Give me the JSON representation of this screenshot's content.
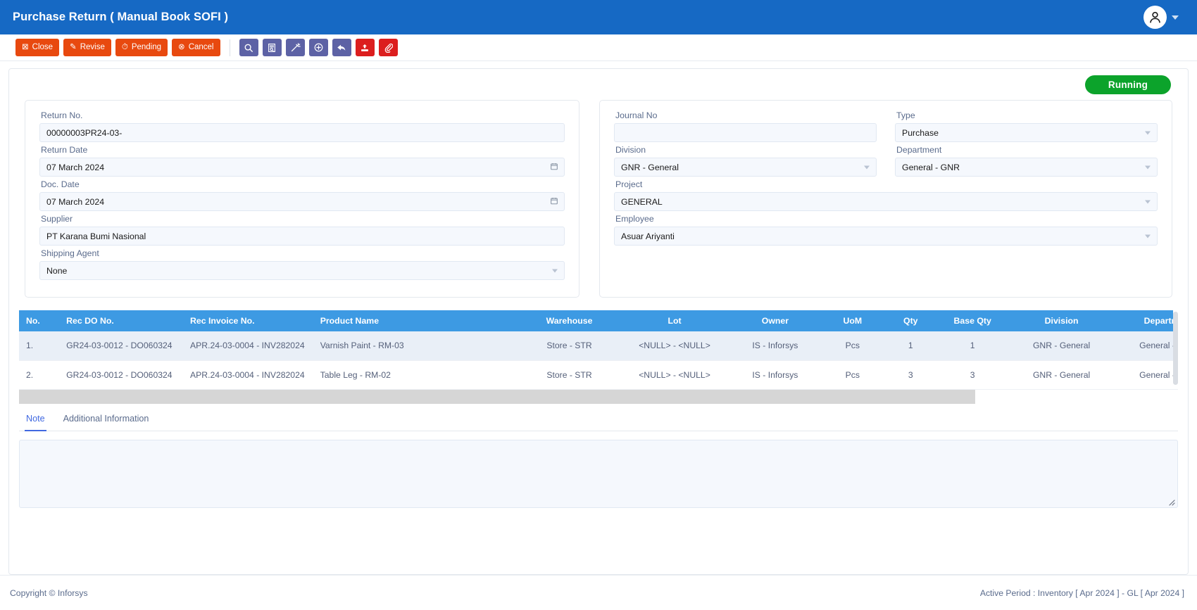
{
  "titlebar": {
    "title": "Purchase Return ( Manual Book SOFI )",
    "avatar_icon": "user-avatar-icon",
    "caret_icon": "chevron-down-icon"
  },
  "toolbar": {
    "buttons": [
      {
        "label": "Close",
        "glyph": "⊠",
        "icon": "close-box-icon"
      },
      {
        "label": "Revise",
        "glyph": "✎",
        "icon": "pencil-square-icon"
      },
      {
        "label": "Pending",
        "glyph": "◴",
        "icon": "clock-icon"
      },
      {
        "label": "Cancel",
        "glyph": "⊗",
        "icon": "cancel-circle-icon"
      }
    ],
    "icon_buttons": [
      {
        "name": "search-icon",
        "color": "#5d62a5"
      },
      {
        "name": "document-search-icon",
        "color": "#5d62a5"
      },
      {
        "name": "magic-wand-icon",
        "color": "#5d62a5"
      },
      {
        "name": "add-circle-icon",
        "color": "#5d62a5"
      },
      {
        "name": "undo-arrow-icon",
        "color": "#5d62a5"
      },
      {
        "name": "upload-icon",
        "color": "#dc1e1e"
      },
      {
        "name": "attachment-icon",
        "color": "#dc1e1e"
      }
    ]
  },
  "status": {
    "label": "Running",
    "color": "#0ca32b"
  },
  "form_left": {
    "return_no": {
      "label": "Return No.",
      "value": "00000003PR24-03-"
    },
    "return_date": {
      "label": "Return Date",
      "value": "07 March 2024",
      "icon": "calendar-icon"
    },
    "doc_date": {
      "label": "Doc. Date",
      "value": "07 March 2024",
      "icon": "calendar-icon"
    },
    "supplier": {
      "label": "Supplier",
      "value": "PT Karana Bumi Nasional"
    },
    "shipping_agent": {
      "label": "Shipping Agent",
      "value": "None",
      "icon": "chevron-down-icon"
    }
  },
  "form_right": {
    "journal_no": {
      "label": "Journal No",
      "value": "",
      "placeholder": ""
    },
    "type": {
      "label": "Type",
      "value": "Purchase",
      "icon": "chevron-down-icon"
    },
    "division": {
      "label": "Division",
      "value": "GNR - General",
      "icon": "chevron-down-icon"
    },
    "department": {
      "label": "Department",
      "value": "General - GNR",
      "icon": "chevron-down-icon"
    },
    "project": {
      "label": "Project",
      "value": "GENERAL",
      "icon": "chevron-down-icon"
    },
    "employee": {
      "label": "Employee",
      "value": "Asuar Ariyanti",
      "icon": "chevron-down-icon"
    }
  },
  "table": {
    "headers": [
      "No.",
      "Rec DO No.",
      "Rec Invoice No.",
      "Product Name",
      "Warehouse",
      "Lot",
      "Owner",
      "UoM",
      "Qty",
      "Base Qty",
      "Division",
      "Department"
    ],
    "rows": [
      {
        "no": "1.",
        "rec_do_no": "GR24-03-0012 - DO060324",
        "rec_invoice_no": "APR.24-03-0004 - INV282024",
        "product_name": "Varnish Paint - RM-03",
        "warehouse": "Store - STR",
        "lot": "<NULL> - <NULL>",
        "owner": "IS - Inforsys",
        "uom": "Pcs",
        "qty": "1",
        "base_qty": "1",
        "division": "GNR - General",
        "department": "General - GNR"
      },
      {
        "no": "2.",
        "rec_do_no": "GR24-03-0012 - DO060324",
        "rec_invoice_no": "APR.24-03-0004 - INV282024",
        "product_name": "Table Leg - RM-02",
        "warehouse": "Store - STR",
        "lot": "<NULL> - <NULL>",
        "owner": "IS - Inforsys",
        "uom": "Pcs",
        "qty": "3",
        "base_qty": "3",
        "division": "GNR - General",
        "department": "General - GNR"
      }
    ]
  },
  "tabs": [
    {
      "label": "Note",
      "active": true
    },
    {
      "label": "Additional Information",
      "active": false
    }
  ],
  "note": {
    "value": "",
    "placeholder": ""
  },
  "footer": {
    "copyright": "Copyright © Inforsys",
    "active_period": "Active Period  :  Inventory [ Apr 2024 ]  -  GL [ Apr 2024 ]"
  }
}
